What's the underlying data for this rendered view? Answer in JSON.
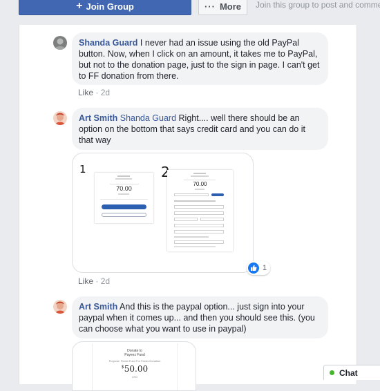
{
  "header": {
    "join_label": "Join Group",
    "more_label": "More",
    "join_prompt": "Join this group to post and comme"
  },
  "comments": [
    {
      "author": "Shanda Guard",
      "text": "I never had an issue using the old PayPal button. Now, when I click on an amount, it takes me to PayPal, but not to the donation page, just to the sign in page. I can't get to FF donation from there.",
      "like_label": "Like",
      "time": "2d"
    },
    {
      "author": "Art Smith",
      "mention": "Shanda Guard",
      "text": "Right.... well there should be an option on the bottom that says credit card and you can do it that way",
      "attachment": {
        "label_1": "1",
        "label_2": "2",
        "amount_1": "70.00",
        "amount_2": "70.00"
      },
      "reaction_count": "1",
      "like_label": "Like",
      "time": "2d"
    },
    {
      "author": "Art Smith",
      "text": "And this is the paypal option... just sign into your paypal when it comes up... and then you should see this. (you can choose what you want to use in paypal)",
      "attachment": {
        "title": "Donate to",
        "subtitle": "Payeez Fund",
        "line": "Purpose: Finest Fund For Feeds Donation",
        "amount": "50.00",
        "currency": "USD"
      }
    }
  ],
  "chat": {
    "label": "Chat"
  },
  "colors": {
    "brand": "#4267b2",
    "link": "#385898",
    "bubble": "#f2f3f5",
    "online": "#42b72a",
    "like_blue": "#1877f2"
  }
}
